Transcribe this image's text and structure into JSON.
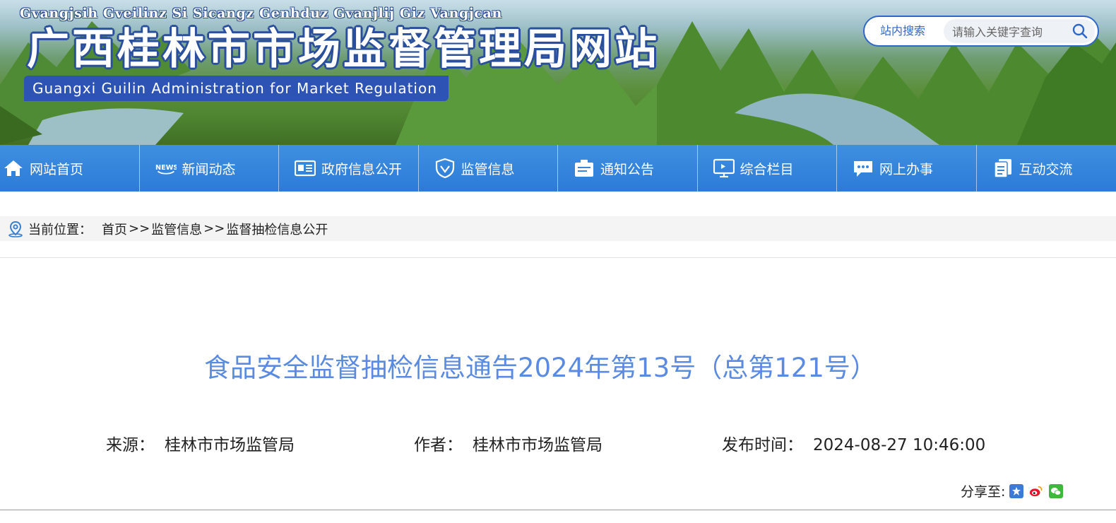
{
  "header": {
    "zhuang_title": "Gvangjsih Gveilinz Si Sicangz Genhduz Gvanjlij Giz Vangjcan",
    "title": "广西桂林市市场监督管理局网站",
    "english_title": "Guangxi Guilin Administration for Market Regulation",
    "search": {
      "label": "站内搜索",
      "placeholder": "请输入关键字查询",
      "icon": "search-icon"
    }
  },
  "nav": {
    "items": [
      {
        "label": "网站首页",
        "icon": "home-icon"
      },
      {
        "label": "新闻动态",
        "icon": "news-icon"
      },
      {
        "label": "政府信息公开",
        "icon": "document-icon"
      },
      {
        "label": "监管信息",
        "icon": "shield-icon"
      },
      {
        "label": "通知公告",
        "icon": "clipboard-icon"
      },
      {
        "label": "综合栏目",
        "icon": "monitor-icon"
      },
      {
        "label": "网上办事",
        "icon": "chat-icon"
      },
      {
        "label": "互动交流",
        "icon": "copy-icon"
      }
    ]
  },
  "breadcrumb": {
    "label": "当前位置：",
    "items": [
      "首页",
      "监管信息",
      "监督抽检信息公开"
    ],
    "separator": ">>"
  },
  "article": {
    "title": "食品安全监督抽检信息通告2024年第13号（总第121号）",
    "source_label": "来源：",
    "source": "桂林市市场监管局",
    "author_label": "作者：",
    "author": "桂林市市场监管局",
    "date_label": "发布时间：",
    "date": "2024-08-27 10:46:00",
    "share_label": "分享至:"
  },
  "colors": {
    "nav_blue": "#2c7bd8",
    "title_blue": "#5b8be0",
    "brand_blue": "#2d53b5"
  }
}
